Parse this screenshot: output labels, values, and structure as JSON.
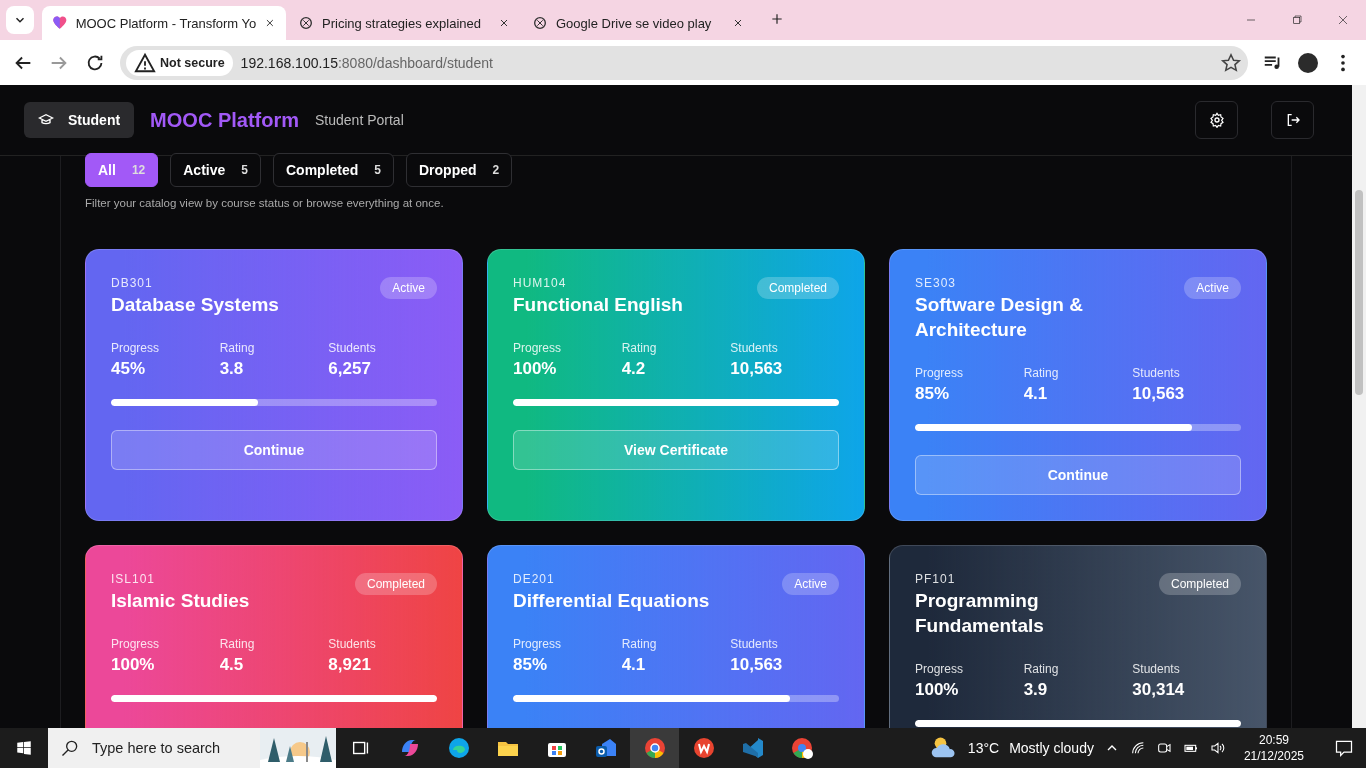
{
  "browser": {
    "tabs": [
      {
        "title": "MOOC Platform - Transform Yo",
        "selected": true
      },
      {
        "title": "Pricing strategies explained",
        "selected": false
      },
      {
        "title": "Google Drive se video play",
        "selected": false
      }
    ],
    "security": "Not secure",
    "url_host": "192.168.100.15",
    "url_rest": ":8080/dashboard/student"
  },
  "header": {
    "role": "Student",
    "brand": "MOOC Platform",
    "subtitle": "Student Portal"
  },
  "filters": [
    {
      "label": "All",
      "count": "12",
      "selected": true
    },
    {
      "label": "Active",
      "count": "5",
      "selected": false
    },
    {
      "label": "Completed",
      "count": "5",
      "selected": false
    },
    {
      "label": "Dropped",
      "count": "2",
      "selected": false
    }
  ],
  "filter_hint": "Filter your catalog view by course status or browse everything at once.",
  "courses": [
    {
      "code": "DB301",
      "title": "Database Systems",
      "status": "Active",
      "color": "#6366f1",
      "progress_label": "Progress",
      "progress": "45%",
      "rating_label": "Rating",
      "rating": "3.8",
      "students_label": "Students",
      "students": "6,257",
      "level": 0.45,
      "button": "Continue"
    },
    {
      "code": "HUM104",
      "title": "Functional English",
      "status": "Completed",
      "color": "#10b981",
      "progress_label": "Progress",
      "progress": "100%",
      "rating_label": "Rating",
      "rating": "4.2",
      "students_label": "Students",
      "students": "10,563",
      "level": 1,
      "button": "View Certificate"
    },
    {
      "code": "SE303",
      "title": "Software Design & Architecture",
      "status": "Active",
      "color": "#3b82f6",
      "progress_label": "Progress",
      "progress": "85%",
      "rating_label": "Rating",
      "rating": "4.1",
      "students_label": "Students",
      "students": "10,563",
      "level": 0.85,
      "button": "Continue"
    },
    {
      "code": "ISL101",
      "title": "Islamic Studies",
      "status": "Completed",
      "color": "#ec4899",
      "progress_label": "Progress",
      "progress": "100%",
      "rating_label": "Rating",
      "rating": "4.5",
      "students_label": "Students",
      "students": "8,921",
      "level": 1
    },
    {
      "code": "DE201",
      "title": "Differential Equations",
      "status": "Active",
      "color": "#3b82f6",
      "progress_label": "Progress",
      "progress": "85%",
      "rating_label": "Rating",
      "rating": "4.1",
      "students_label": "Students",
      "students": "10,563",
      "level": 0.85
    },
    {
      "code": "PF101",
      "title": "Programming Fundamentals",
      "status": "Completed",
      "color": "#1e293b",
      "progress_label": "Progress",
      "progress": "100%",
      "rating_label": "Rating",
      "rating": "3.9",
      "students_label": "Students",
      "students": "30,314",
      "level": 1
    }
  ],
  "taskbar": {
    "search_placeholder": "Type here to search",
    "temperature": "13°C",
    "weather": "Mostly cloudy",
    "time": "20:59",
    "date": "21/12/2025"
  }
}
